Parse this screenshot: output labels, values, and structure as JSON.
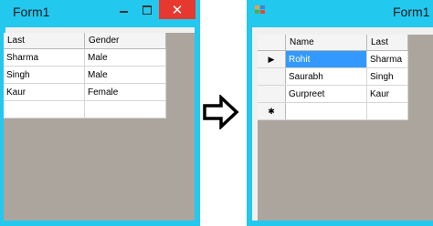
{
  "left_window": {
    "title": "Form1",
    "controls": {
      "minimize": "",
      "maximize": "",
      "close": "✕"
    },
    "grid": {
      "columns": [
        "Last",
        "Gender"
      ],
      "rows": [
        [
          "Sharma",
          "Male"
        ],
        [
          "Singh",
          "Male"
        ],
        [
          "Kaur",
          "Female"
        ],
        [
          "",
          ""
        ]
      ]
    }
  },
  "right_window": {
    "title": "Form1",
    "grid": {
      "columns": [
        "Name",
        "Last"
      ],
      "row_markers": [
        "▶",
        "",
        "",
        "✱"
      ],
      "rows": [
        [
          "Rohit",
          "Sharma"
        ],
        [
          "Saurabh",
          "Singh"
        ],
        [
          "Gurpreet",
          "Kaur"
        ],
        [
          "",
          ""
        ]
      ],
      "selected_cell": "Rohit"
    }
  },
  "colors": {
    "title_bar": "#23c8ef",
    "close_button": "#e7382f",
    "grid_background": "#aba59e",
    "selection": "#3399ff"
  },
  "icons": [
    "minimize-icon",
    "maximize-icon",
    "close-icon",
    "form-app-icon",
    "right-arrow-icon",
    "current-row-icon",
    "new-row-icon"
  ]
}
